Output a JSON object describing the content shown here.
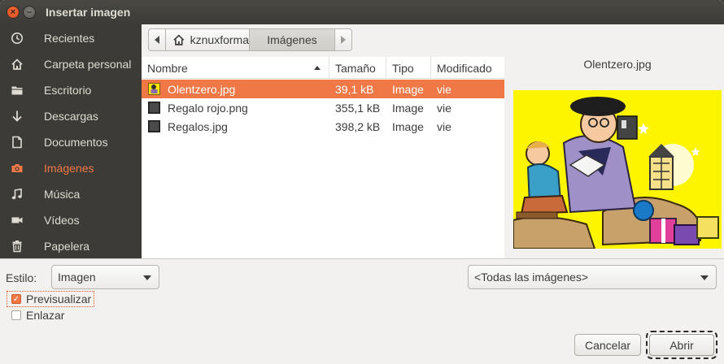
{
  "window": {
    "title": "Insertar imagen",
    "close_glyph": "×",
    "minimize_glyph": "–"
  },
  "sidebar": {
    "items": [
      {
        "label": "Recientes",
        "icon": "clock-icon"
      },
      {
        "label": "Carpeta personal",
        "icon": "home-icon"
      },
      {
        "label": "Escritorio",
        "icon": "folder-icon"
      },
      {
        "label": "Descargas",
        "icon": "download-arrow-icon"
      },
      {
        "label": "Documentos",
        "icon": "document-icon"
      },
      {
        "label": "Imágenes",
        "icon": "camera-icon",
        "active": true
      },
      {
        "label": "Música",
        "icon": "music-note-icon"
      },
      {
        "label": "Vídeos",
        "icon": "video-camera-icon"
      },
      {
        "label": "Papelera",
        "icon": "trash-icon"
      }
    ]
  },
  "pathbar": {
    "home_label": "kznuxforma",
    "current_label": "Imágenes"
  },
  "filelist": {
    "columns": [
      "Nombre",
      "Tamaño",
      "Tipo",
      "Modificado"
    ],
    "sort_column": "Nombre",
    "rows": [
      {
        "name": "Olentzero.jpg",
        "size": "39,1 kB",
        "type": "Image",
        "modified": "vie",
        "selected": true
      },
      {
        "name": "Regalo rojo.png",
        "size": "355,1 kB",
        "type": "Image",
        "modified": "vie"
      },
      {
        "name": "Regalos.jpg",
        "size": "398,2 kB",
        "type": "Image",
        "modified": "vie"
      }
    ]
  },
  "preview": {
    "filename": "Olentzero.jpg"
  },
  "options": {
    "style_label": "Estilo:",
    "style_value": "Imagen",
    "filter_value": "<Todas las imágenes>",
    "preview_checkbox_label": "Previsualizar",
    "preview_checked": true,
    "link_checkbox_label": "Enlazar",
    "link_checked": false,
    "check_glyph": "✓"
  },
  "buttons": {
    "cancel": "Cancelar",
    "open": "Abrir"
  },
  "colors": {
    "accent": "#f07746",
    "sidebar_bg": "#3c3b37",
    "sidebar_text": "#dfdbd2",
    "preview_bg": "#fdf400"
  }
}
